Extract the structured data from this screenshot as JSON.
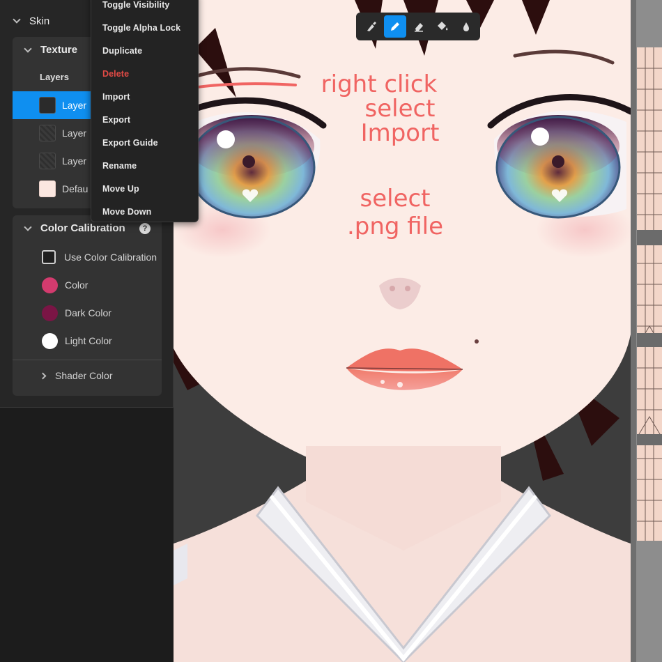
{
  "sidebar": {
    "section_title": "Skin",
    "texture": {
      "title": "Texture",
      "layers_label": "Layers",
      "layers": [
        {
          "label": "Layer",
          "thumb": "dark",
          "selected": true
        },
        {
          "label": "Layer",
          "thumb": "texture",
          "selected": false
        },
        {
          "label": "Layer",
          "thumb": "texture",
          "selected": false
        },
        {
          "label": "Defau",
          "thumb": "skin",
          "selected": false
        }
      ]
    },
    "color_calibration": {
      "title": "Color Calibration",
      "help": "?",
      "use_label": "Use Color Calibration",
      "color_label": "Color",
      "dark_color_label": "Dark Color",
      "light_color_label": "Light Color",
      "color_hex": "#d33b6e",
      "dark_color_hex": "#7a1545",
      "light_color_hex": "#ffffff",
      "shader_color_label": "Shader Color"
    }
  },
  "context_menu": {
    "items": [
      {
        "label": "Toggle Visibility"
      },
      {
        "label": "Toggle Alpha Lock"
      },
      {
        "label": "Duplicate"
      },
      {
        "label": "Delete",
        "danger": true
      },
      {
        "label": "Import"
      },
      {
        "label": "Export"
      },
      {
        "label": "Export Guide"
      },
      {
        "label": "Rename"
      },
      {
        "label": "Move Up"
      },
      {
        "label": "Move Down"
      }
    ]
  },
  "toolbar": {
    "tools": [
      {
        "icon": "brush-icon",
        "active": false
      },
      {
        "icon": "pencil-icon",
        "active": true
      },
      {
        "icon": "eraser-icon",
        "active": false
      },
      {
        "icon": "fill-bucket-icon",
        "active": false
      },
      {
        "icon": "eyedropper-icon",
        "active": false
      }
    ]
  },
  "annotation": {
    "line1": "right click",
    "line2": "select",
    "line3": "Import",
    "line4": "select",
    "line5": ".png file",
    "color": "#f06462"
  },
  "colors": {
    "accent": "#0f8ff0",
    "danger": "#e04a45",
    "skin": "#fcece6",
    "hair": "#2c0e0e"
  }
}
